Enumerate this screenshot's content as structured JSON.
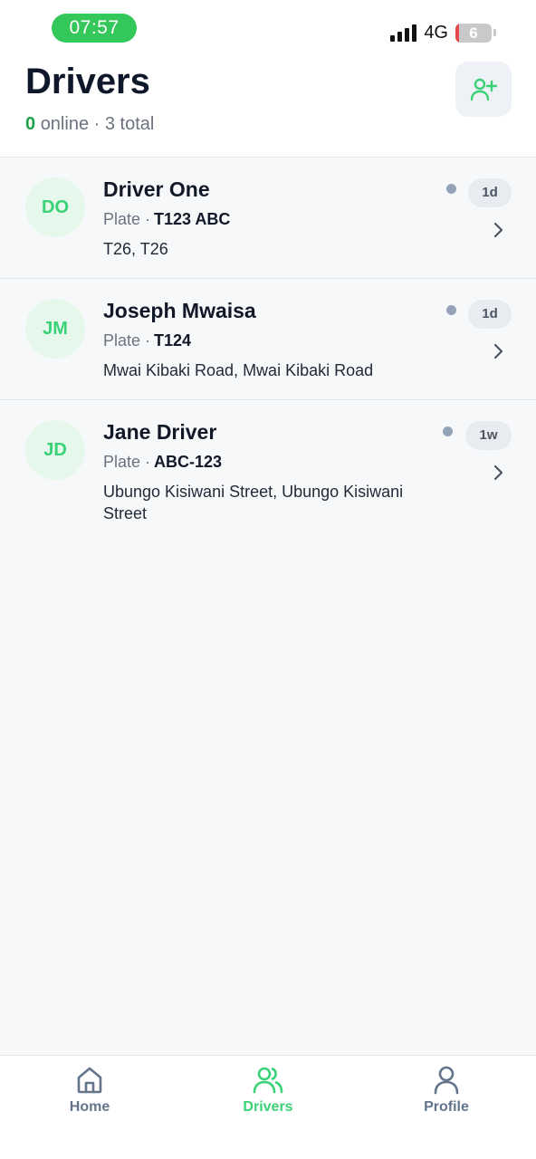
{
  "status_bar": {
    "time": "07:57",
    "network": "4G",
    "battery": "6",
    "signal_icon": "signal-bars-icon"
  },
  "header": {
    "title": "Drivers",
    "online_count": "0",
    "online_label": "online",
    "separator": "·",
    "total_label": "3 total",
    "add_icon": "add-user-icon"
  },
  "drivers": [
    {
      "initials": "DO",
      "name": "Driver One",
      "plate_label": "Plate ·",
      "plate": "T123 ABC",
      "address": "T26, T26",
      "last_seen": "1d"
    },
    {
      "initials": "JM",
      "name": "Joseph Mwaisa",
      "plate_label": "Plate ·",
      "plate": "T124",
      "address": "Mwai Kibaki Road, Mwai Kibaki Road",
      "last_seen": "1d"
    },
    {
      "initials": "JD",
      "name": "Jane Driver",
      "plate_label": "Plate ·",
      "plate": "ABC-123",
      "address": "Ubungo Kisiwani Street, Ubungo Kisiwani Street",
      "last_seen": "1w"
    }
  ],
  "tabbar": {
    "tabs": [
      {
        "label": "Home",
        "icon": "home-icon",
        "active": false
      },
      {
        "label": "Drivers",
        "icon": "users-icon",
        "active": true
      },
      {
        "label": "Profile",
        "icon": "user-icon",
        "active": false
      }
    ]
  },
  "colors": {
    "accent": "#39d277",
    "online": "#22a04b",
    "status_dot": "#94a3b8",
    "status_pill": "#34c759"
  }
}
